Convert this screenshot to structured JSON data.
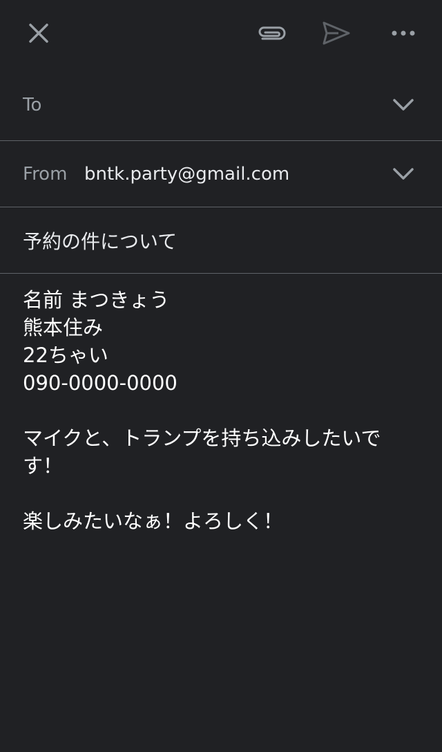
{
  "toolbar": {
    "icons": [
      "close-icon",
      "attach-icon",
      "send-icon",
      "more-icon"
    ]
  },
  "to": {
    "label": "To"
  },
  "from": {
    "label": "From",
    "value": "bntk.party@gmail.com"
  },
  "subject": "予約の件について",
  "body": {
    "lines": [
      "名前 まつきょう",
      "熊本住み",
      "22ちゃい",
      "090-0000-0000",
      "",
      "マイクと、トランプを持ち込みしたいで",
      "す！",
      "",
      "楽しみたいなぁ！よろしく！"
    ]
  },
  "colors": {
    "background": "#202124",
    "divider": "#5f6368",
    "label": "#9aa0a6",
    "text": "#e8eaed"
  }
}
